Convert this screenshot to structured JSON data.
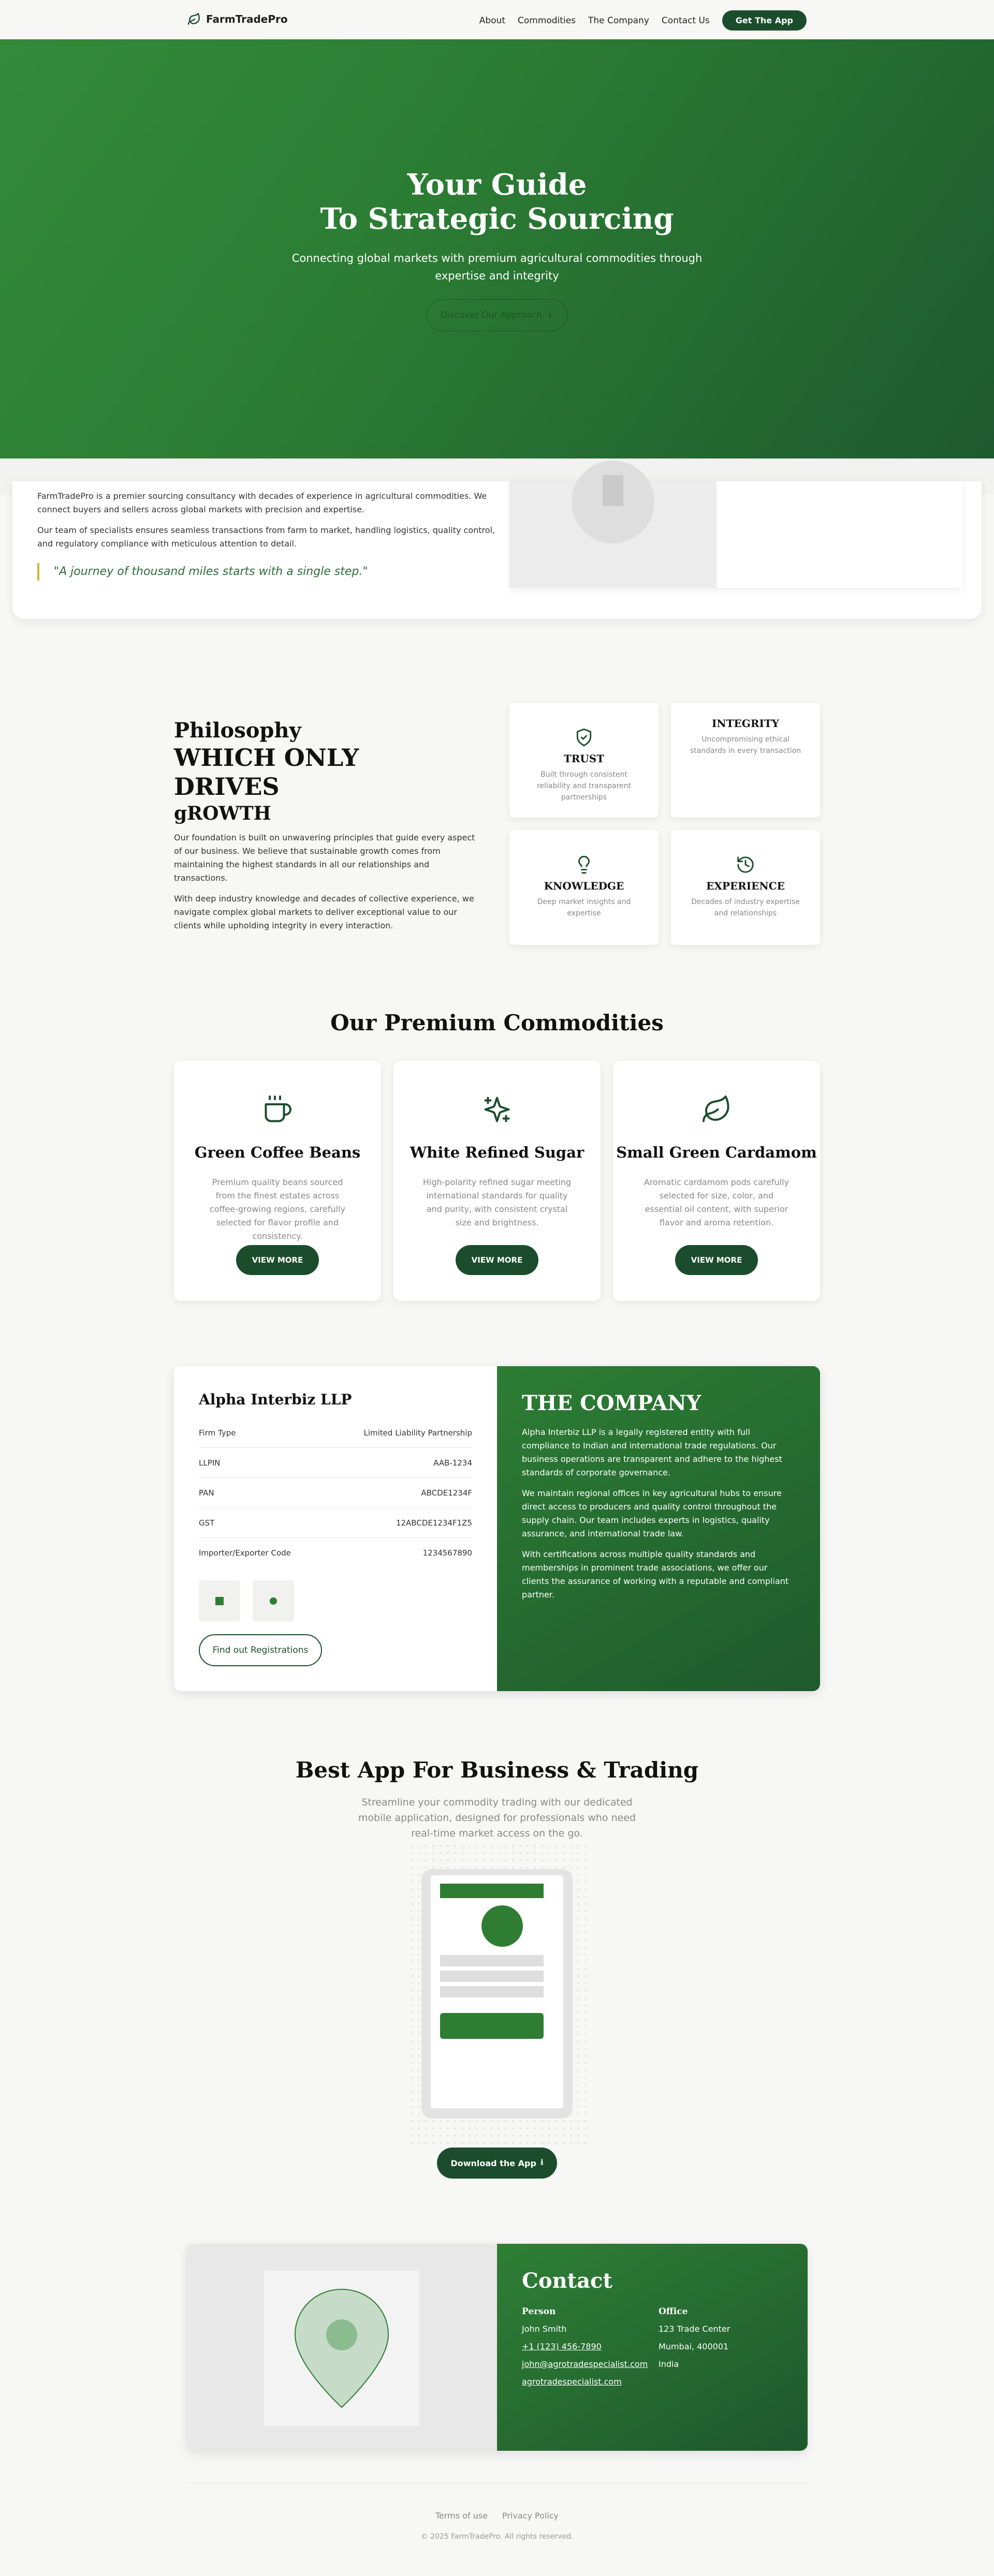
{
  "nav": {
    "brand": "FarmTradePro",
    "links": [
      "About",
      "Commodities",
      "The Company",
      "Contact Us"
    ],
    "cta": "Get The App"
  },
  "hero": {
    "title_line1": "Your Guide",
    "title_line2": "To Strategic Sourcing",
    "subtitle": "Connecting global markets with premium agricultural commodities through expertise and integrity",
    "button": "Discover Our Approach"
  },
  "about": {
    "paragraphs": [
      "FarmTradePro is a premier sourcing consultancy with decades of experience in agricultural commodities. We connect buyers and sellers across global markets with precision and expertise.",
      "Our team of specialists ensures seamless transactions from farm to market, handling logistics, quality control, and regulatory compliance with meticulous attention to detail."
    ],
    "quote": "\"A journey of thousand miles starts with a single step.\""
  },
  "philosophy": {
    "title_1": "Philosophy",
    "title_2": "WHICH ONLY",
    "title_3": "DRIVES",
    "title_4": "gROWTH",
    "paragraphs": [
      "Our foundation is built on unwavering principles that guide every aspect of our business. We believe that sustainable growth comes from maintaining the highest standards in all our relationships and transactions.",
      "With deep industry knowledge and decades of collective experience, we navigate complex global markets to deliver exceptional value to our clients while upholding integrity in every interaction."
    ],
    "values": [
      {
        "icon": "shield-check-icon",
        "title": "TRUST",
        "desc": "Built through consistent reliability and transparent partnerships"
      },
      {
        "icon": "",
        "title": "INTEGRITY",
        "desc": "Uncompromising ethical standards in every transaction"
      },
      {
        "icon": "lightbulb-icon",
        "title": "KNOWLEDGE",
        "desc": "Deep market insights and expertise"
      },
      {
        "icon": "history-icon",
        "title": "EXPERIENCE",
        "desc": "Decades of industry expertise and relationships"
      }
    ]
  },
  "commodities": {
    "title": "Our Premium Commodities",
    "items": [
      {
        "icon": "coffee-cup-icon",
        "title": "Green Coffee Beans",
        "desc": "Premium quality beans sourced from the finest estates across coffee-growing regions, carefully selected for flavor profile and consistency.",
        "button": "VIEW MORE"
      },
      {
        "icon": "sparkles-icon",
        "title": "White Refined Sugar",
        "desc": "High-polarity refined sugar meeting international standards for quality and purity, with consistent crystal size and brightness.",
        "button": "VIEW MORE"
      },
      {
        "icon": "leaf-icon",
        "title": "Small Green Cardamom",
        "desc": "Aromatic cardamom pods carefully selected for size, color, and essential oil content, with superior flavor and aroma retention.",
        "button": "VIEW MORE"
      }
    ]
  },
  "company": {
    "name": "Alpha Interbiz LLP",
    "rows": [
      {
        "label": "Firm Type",
        "value": "Limited Liability Partnership"
      },
      {
        "label": "LLPIN",
        "value": "AAB-1234"
      },
      {
        "label": "PAN",
        "value": "ABCDE1234F"
      },
      {
        "label": "GST",
        "value": "12ABCDE1234F1Z5"
      },
      {
        "label": "Importer/Exporter Code",
        "value": "1234567890"
      }
    ],
    "button": "Find out Registrations",
    "heading": "THE COMPANY",
    "paragraphs": [
      "Alpha Interbiz LLP is a legally registered entity with full compliance to Indian and international trade regulations. Our business operations are transparent and adhere to the highest standards of corporate governance.",
      "We maintain regional offices in key agricultural hubs to ensure direct access to producers and quality control throughout the supply chain. Our team includes experts in logistics, quality assurance, and international trade law.",
      "With certifications across multiple quality standards and memberships in prominent trade associations, we offer our clients the assurance of working with a reputable and compliant partner."
    ]
  },
  "app": {
    "title": "Best App For Business & Trading",
    "subtitle": "Streamline your commodity trading with our dedicated mobile application, designed for professionals who need real-time market access on the go.",
    "button": "Download the App"
  },
  "contact": {
    "heading": "Contact",
    "person": {
      "label": "Person",
      "name": "John Smith",
      "phone": "+1 (123) 456-7890",
      "email": "john@agrotradespecialist.com",
      "website": "agrotradespecialist.com"
    },
    "office": {
      "label": "Office",
      "line1": "123 Trade Center",
      "line2": "Mumbai, 400001",
      "line3": "India"
    }
  },
  "footer": {
    "links": [
      "Terms of use",
      "Privacy Policy"
    ],
    "copyright": "© 2025 FarmTradePro. All rights reserved."
  },
  "colors": {
    "brand_dark": "#1b4d2c",
    "brand_green": "#2e7d32",
    "accent_gold": "#d3b23c"
  }
}
